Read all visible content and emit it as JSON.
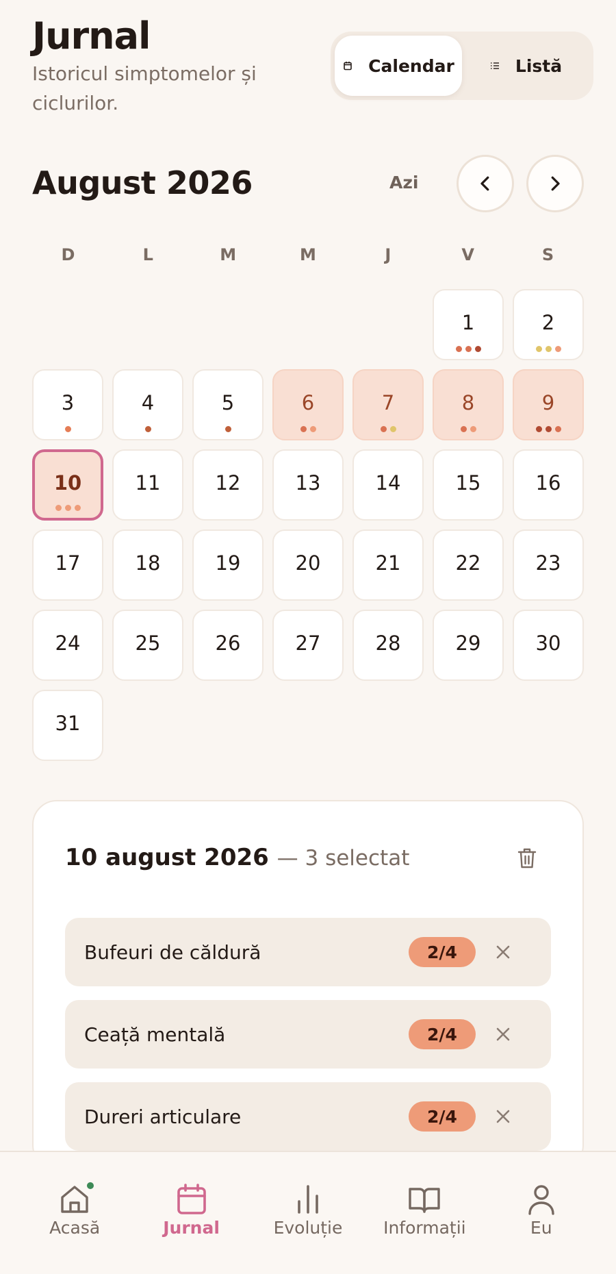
{
  "header": {
    "title": "Jurnal",
    "subtitle": "Istoricul simptomelor și ciclurilor.",
    "view_toggle": {
      "calendar_label": "Calendar",
      "list_label": "Listă",
      "active": "calendar"
    }
  },
  "calendar": {
    "month_title": "August 2026",
    "today_label": "Azi",
    "weekdays": [
      "D",
      "L",
      "M",
      "M",
      "J",
      "V",
      "S"
    ],
    "leading_empty": 5,
    "days": [
      {
        "n": "1",
        "state": "normal",
        "dots": [
          "#d97152",
          "#d97152",
          "#b04a32"
        ]
      },
      {
        "n": "2",
        "state": "normal",
        "dots": [
          "#e0c56a",
          "#e0c56a",
          "#ee9b78"
        ]
      },
      {
        "n": "3",
        "state": "normal",
        "dots": [
          "#e57d56"
        ]
      },
      {
        "n": "4",
        "state": "normal",
        "dots": [
          "#c0603a"
        ]
      },
      {
        "n": "5",
        "state": "normal",
        "dots": [
          "#c0603a"
        ]
      },
      {
        "n": "6",
        "state": "tinted",
        "dots": [
          "#d97152",
          "#ee9b78"
        ]
      },
      {
        "n": "7",
        "state": "tinted",
        "dots": [
          "#d97152",
          "#e0c56a"
        ]
      },
      {
        "n": "8",
        "state": "tinted",
        "dots": [
          "#d97152",
          "#ee9b78"
        ]
      },
      {
        "n": "9",
        "state": "tinted",
        "dots": [
          "#b04a32",
          "#b04a32",
          "#d97152"
        ]
      },
      {
        "n": "10",
        "state": "today",
        "dots": [
          "#ee9b78",
          "#ee9b78",
          "#ee9b78"
        ]
      },
      {
        "n": "11",
        "state": "normal",
        "dots": []
      },
      {
        "n": "12",
        "state": "normal",
        "dots": []
      },
      {
        "n": "13",
        "state": "normal",
        "dots": []
      },
      {
        "n": "14",
        "state": "normal",
        "dots": []
      },
      {
        "n": "15",
        "state": "normal",
        "dots": []
      },
      {
        "n": "16",
        "state": "normal",
        "dots": []
      },
      {
        "n": "17",
        "state": "normal",
        "dots": []
      },
      {
        "n": "18",
        "state": "normal",
        "dots": []
      },
      {
        "n": "19",
        "state": "normal",
        "dots": []
      },
      {
        "n": "20",
        "state": "normal",
        "dots": []
      },
      {
        "n": "21",
        "state": "normal",
        "dots": []
      },
      {
        "n": "22",
        "state": "normal",
        "dots": []
      },
      {
        "n": "23",
        "state": "normal",
        "dots": []
      },
      {
        "n": "24",
        "state": "normal",
        "dots": []
      },
      {
        "n": "25",
        "state": "normal",
        "dots": []
      },
      {
        "n": "26",
        "state": "normal",
        "dots": []
      },
      {
        "n": "27",
        "state": "normal",
        "dots": []
      },
      {
        "n": "28",
        "state": "normal",
        "dots": []
      },
      {
        "n": "29",
        "state": "normal",
        "dots": []
      },
      {
        "n": "30",
        "state": "normal",
        "dots": []
      },
      {
        "n": "31",
        "state": "normal",
        "dots": []
      }
    ]
  },
  "detail": {
    "date": "10 august 2026",
    "selected": "— 3 selectat",
    "symptoms": [
      {
        "name": "Bufeuri de căldură",
        "severity": "2/4"
      },
      {
        "name": "Ceață mentală",
        "severity": "2/4"
      },
      {
        "name": "Dureri articulare",
        "severity": "2/4"
      }
    ]
  },
  "bottom_nav": {
    "items": [
      {
        "label": "Acasă",
        "icon": "home-icon"
      },
      {
        "label": "Jurnal",
        "icon": "calendar-icon"
      },
      {
        "label": "Evoluție",
        "icon": "bar-chart-icon"
      },
      {
        "label": "Informații",
        "icon": "book-icon"
      },
      {
        "label": "Eu",
        "icon": "user-icon"
      }
    ],
    "active": "Jurnal"
  },
  "colors": {
    "accent": "#d0688e",
    "background": "#faf6f2",
    "tinted_day": "#f9dfd3",
    "severity_badge": "#ee9b78",
    "notification": "#3d8a56"
  }
}
